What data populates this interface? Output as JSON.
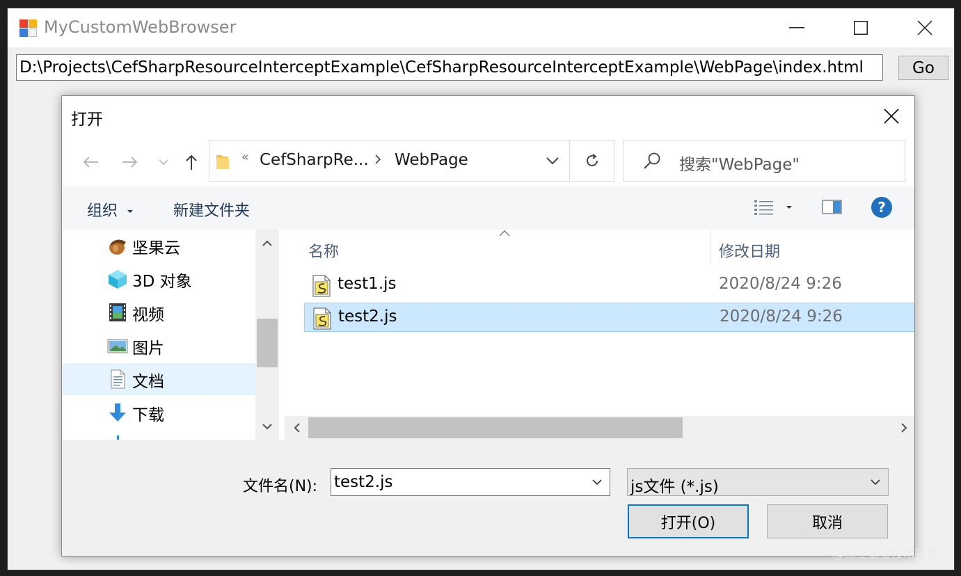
{
  "app": {
    "title": "MyCustomWebBrowser",
    "url": "D:\\Projects\\CefSharpResourceInterceptExample\\CefSharpResourceInterceptExample\\WebPage\\index.html",
    "go_label": "Go"
  },
  "dialog": {
    "title": "打开",
    "address": {
      "overflow_marker": "«",
      "crumb_parent": "CefSharpRe...",
      "crumb_current": "WebPage"
    },
    "search_placeholder": "搜索\"WebPage\"",
    "toolbar": {
      "organize_label": "组织",
      "new_folder_label": "新建文件夹"
    },
    "nav_items": [
      {
        "label": "坚果云",
        "icon": "nut-cloud-icon"
      },
      {
        "label": "3D 对象",
        "icon": "3d-objects-icon"
      },
      {
        "label": "视频",
        "icon": "video-icon"
      },
      {
        "label": "图片",
        "icon": "pictures-icon"
      },
      {
        "label": "文档",
        "icon": "documents-icon",
        "selected": true
      },
      {
        "label": "下载",
        "icon": "download-icon"
      }
    ],
    "columns": {
      "name": "名称",
      "date": "修改日期"
    },
    "files": [
      {
        "name": "test1.js",
        "date": "2020/8/24 9:26",
        "selected": false
      },
      {
        "name": "test2.js",
        "date": "2020/8/24 9:26",
        "selected": true
      }
    ],
    "filename_label": "文件名(N):",
    "filename_value": "test2.js",
    "filetype_value": "js文件 (*.js)",
    "open_label": "打开(O)",
    "cancel_label": "取消"
  },
  "watermark": "@稀土掘金技术社区",
  "colors": {
    "accent": "#0078d7",
    "selection": "#cce8ff",
    "nav_selection": "#e5f3ff",
    "help": "#1f6fbf"
  }
}
